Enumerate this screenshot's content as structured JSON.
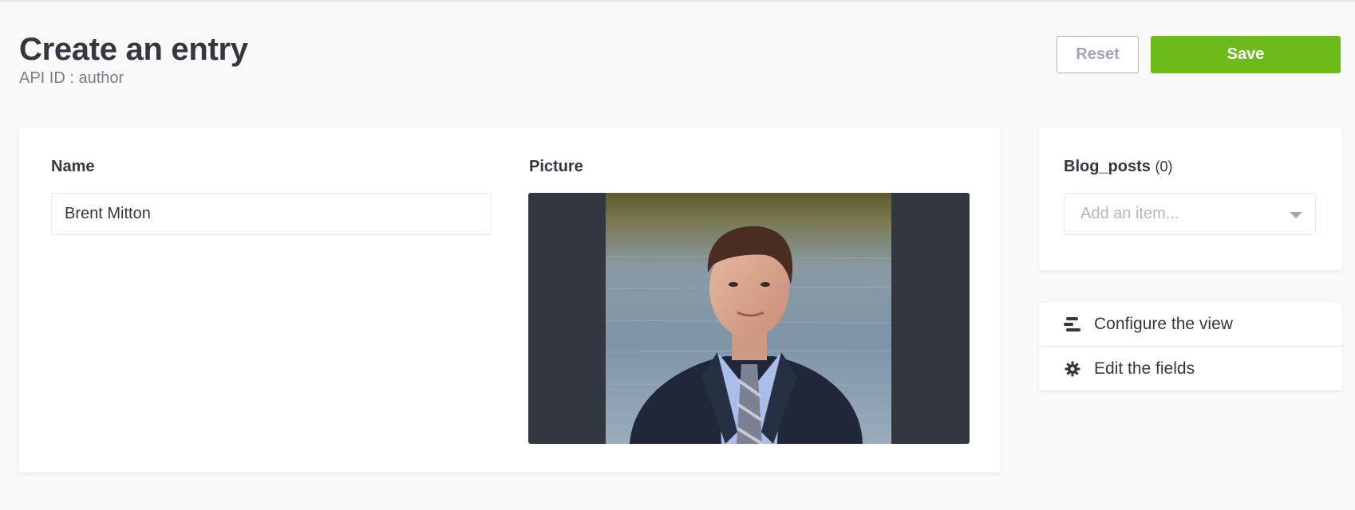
{
  "header": {
    "title": "Create an entry",
    "subtitle": "API ID : author"
  },
  "actions": {
    "reset_label": "Reset",
    "save_label": "Save"
  },
  "form": {
    "name_label": "Name",
    "name_value": "Brent Mitton",
    "picture_label": "Picture"
  },
  "relation": {
    "label": "Blog_posts",
    "count": "(0)",
    "placeholder": "Add an item..."
  },
  "menu": {
    "configure_label": "Configure the view",
    "edit_fields_label": "Edit the fields"
  },
  "colors": {
    "accent": "#6dbb1a",
    "text": "#333740",
    "muted": "#787e8f",
    "picture_bg": "#333740"
  }
}
